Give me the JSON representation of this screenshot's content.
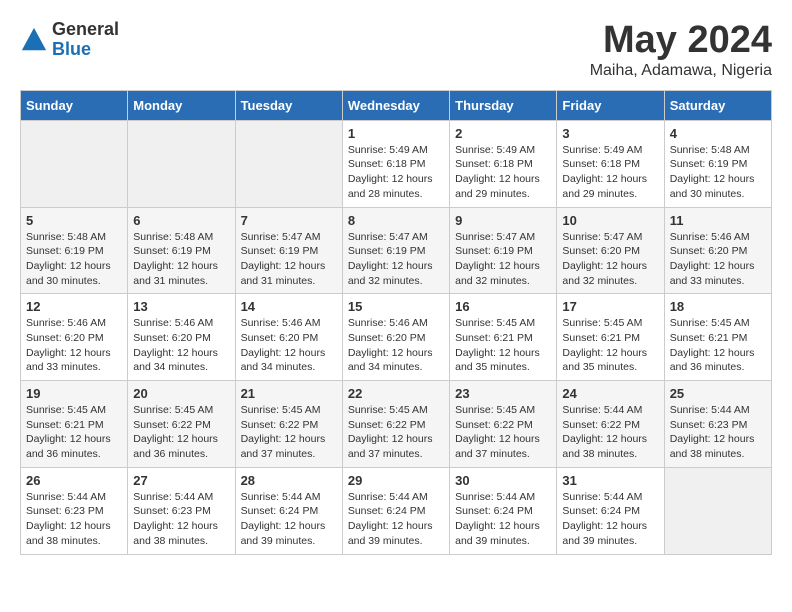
{
  "logo": {
    "general": "General",
    "blue": "Blue"
  },
  "title": "May 2024",
  "location": "Maiha, Adamawa, Nigeria",
  "weekdays": [
    "Sunday",
    "Monday",
    "Tuesday",
    "Wednesday",
    "Thursday",
    "Friday",
    "Saturday"
  ],
  "weeks": [
    [
      {
        "day": "",
        "info": ""
      },
      {
        "day": "",
        "info": ""
      },
      {
        "day": "",
        "info": ""
      },
      {
        "day": "1",
        "info": "Sunrise: 5:49 AM\nSunset: 6:18 PM\nDaylight: 12 hours\nand 28 minutes."
      },
      {
        "day": "2",
        "info": "Sunrise: 5:49 AM\nSunset: 6:18 PM\nDaylight: 12 hours\nand 29 minutes."
      },
      {
        "day": "3",
        "info": "Sunrise: 5:49 AM\nSunset: 6:18 PM\nDaylight: 12 hours\nand 29 minutes."
      },
      {
        "day": "4",
        "info": "Sunrise: 5:48 AM\nSunset: 6:19 PM\nDaylight: 12 hours\nand 30 minutes."
      }
    ],
    [
      {
        "day": "5",
        "info": "Sunrise: 5:48 AM\nSunset: 6:19 PM\nDaylight: 12 hours\nand 30 minutes."
      },
      {
        "day": "6",
        "info": "Sunrise: 5:48 AM\nSunset: 6:19 PM\nDaylight: 12 hours\nand 31 minutes."
      },
      {
        "day": "7",
        "info": "Sunrise: 5:47 AM\nSunset: 6:19 PM\nDaylight: 12 hours\nand 31 minutes."
      },
      {
        "day": "8",
        "info": "Sunrise: 5:47 AM\nSunset: 6:19 PM\nDaylight: 12 hours\nand 32 minutes."
      },
      {
        "day": "9",
        "info": "Sunrise: 5:47 AM\nSunset: 6:19 PM\nDaylight: 12 hours\nand 32 minutes."
      },
      {
        "day": "10",
        "info": "Sunrise: 5:47 AM\nSunset: 6:20 PM\nDaylight: 12 hours\nand 32 minutes."
      },
      {
        "day": "11",
        "info": "Sunrise: 5:46 AM\nSunset: 6:20 PM\nDaylight: 12 hours\nand 33 minutes."
      }
    ],
    [
      {
        "day": "12",
        "info": "Sunrise: 5:46 AM\nSunset: 6:20 PM\nDaylight: 12 hours\nand 33 minutes."
      },
      {
        "day": "13",
        "info": "Sunrise: 5:46 AM\nSunset: 6:20 PM\nDaylight: 12 hours\nand 34 minutes."
      },
      {
        "day": "14",
        "info": "Sunrise: 5:46 AM\nSunset: 6:20 PM\nDaylight: 12 hours\nand 34 minutes."
      },
      {
        "day": "15",
        "info": "Sunrise: 5:46 AM\nSunset: 6:20 PM\nDaylight: 12 hours\nand 34 minutes."
      },
      {
        "day": "16",
        "info": "Sunrise: 5:45 AM\nSunset: 6:21 PM\nDaylight: 12 hours\nand 35 minutes."
      },
      {
        "day": "17",
        "info": "Sunrise: 5:45 AM\nSunset: 6:21 PM\nDaylight: 12 hours\nand 35 minutes."
      },
      {
        "day": "18",
        "info": "Sunrise: 5:45 AM\nSunset: 6:21 PM\nDaylight: 12 hours\nand 36 minutes."
      }
    ],
    [
      {
        "day": "19",
        "info": "Sunrise: 5:45 AM\nSunset: 6:21 PM\nDaylight: 12 hours\nand 36 minutes."
      },
      {
        "day": "20",
        "info": "Sunrise: 5:45 AM\nSunset: 6:22 PM\nDaylight: 12 hours\nand 36 minutes."
      },
      {
        "day": "21",
        "info": "Sunrise: 5:45 AM\nSunset: 6:22 PM\nDaylight: 12 hours\nand 37 minutes."
      },
      {
        "day": "22",
        "info": "Sunrise: 5:45 AM\nSunset: 6:22 PM\nDaylight: 12 hours\nand 37 minutes."
      },
      {
        "day": "23",
        "info": "Sunrise: 5:45 AM\nSunset: 6:22 PM\nDaylight: 12 hours\nand 37 minutes."
      },
      {
        "day": "24",
        "info": "Sunrise: 5:44 AM\nSunset: 6:22 PM\nDaylight: 12 hours\nand 38 minutes."
      },
      {
        "day": "25",
        "info": "Sunrise: 5:44 AM\nSunset: 6:23 PM\nDaylight: 12 hours\nand 38 minutes."
      }
    ],
    [
      {
        "day": "26",
        "info": "Sunrise: 5:44 AM\nSunset: 6:23 PM\nDaylight: 12 hours\nand 38 minutes."
      },
      {
        "day": "27",
        "info": "Sunrise: 5:44 AM\nSunset: 6:23 PM\nDaylight: 12 hours\nand 38 minutes."
      },
      {
        "day": "28",
        "info": "Sunrise: 5:44 AM\nSunset: 6:24 PM\nDaylight: 12 hours\nand 39 minutes."
      },
      {
        "day": "29",
        "info": "Sunrise: 5:44 AM\nSunset: 6:24 PM\nDaylight: 12 hours\nand 39 minutes."
      },
      {
        "day": "30",
        "info": "Sunrise: 5:44 AM\nSunset: 6:24 PM\nDaylight: 12 hours\nand 39 minutes."
      },
      {
        "day": "31",
        "info": "Sunrise: 5:44 AM\nSunset: 6:24 PM\nDaylight: 12 hours\nand 39 minutes."
      },
      {
        "day": "",
        "info": ""
      }
    ]
  ]
}
